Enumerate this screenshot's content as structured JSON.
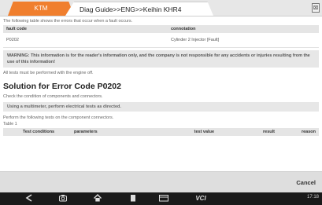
{
  "tabs": {
    "active": "KTM",
    "path": "Diag Guide>>ENG>>Keihin KHR4",
    "close_icon": "⊠"
  },
  "intro": "The following table shows the errors that occur when a fault occurs.",
  "fault_table": {
    "headers": [
      "fault code",
      "connotation"
    ],
    "rows": [
      [
        "P0202",
        "Cylinder 2 Injector [Fault]"
      ]
    ]
  },
  "warning": "WARNING: This information is for the reader's information only, and the company is not responsible for any accidents or injuries resulting from the use of this information!",
  "all_tests_note": "All tests must be performed with the engine off.",
  "solution_title": "Solution for Error Code P0202",
  "check_text": "Check the condition of components and connectors.",
  "multimeter_text": "Using a multimeter, perform electrical tests as directed.",
  "perform_text": "Perform the following tests on the component connectors.",
  "table_label": "Table 1",
  "tests_table": {
    "headers": [
      "Test conditions",
      "parameters",
      "test value",
      "result",
      "reason"
    ]
  },
  "cancel_label": "Cancel",
  "navbar": {
    "icons": [
      "back-icon",
      "camera-icon",
      "home-icon",
      "document-icon",
      "window-icon",
      "vci-icon"
    ],
    "vci_label": "VCI",
    "time": "17:18"
  }
}
